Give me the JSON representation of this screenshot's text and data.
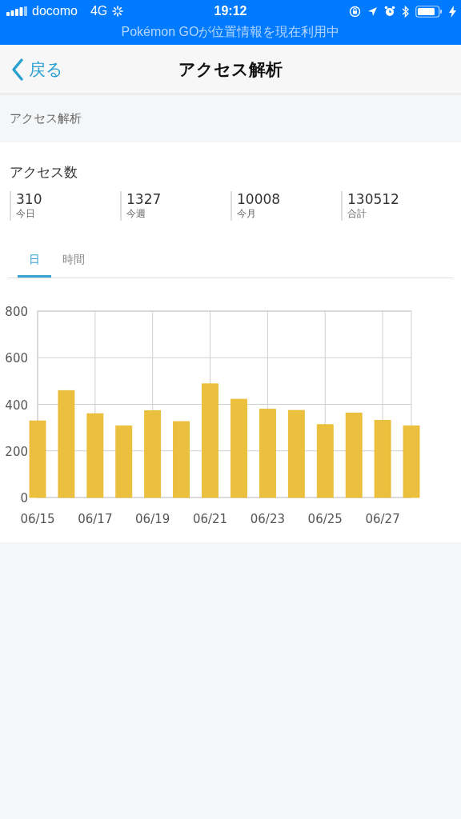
{
  "status_bar": {
    "carrier": "docomo",
    "network": "4G",
    "time": "19:12",
    "banner": "Pokémon GOが位置情報を現在利用中"
  },
  "nav": {
    "back": "戻る",
    "title": "アクセス解析"
  },
  "section_header": "アクセス解析",
  "card": {
    "title": "アクセス数",
    "stats": [
      {
        "value": "310",
        "label": "今日"
      },
      {
        "value": "1327",
        "label": "今週"
      },
      {
        "value": "10008",
        "label": "今月"
      },
      {
        "value": "130512",
        "label": "合計"
      }
    ],
    "tabs": [
      {
        "label": "日",
        "selected": true
      },
      {
        "label": "時間",
        "selected": false
      }
    ],
    "chart_data": {
      "type": "bar",
      "grid": true,
      "categories": [
        "06/15",
        null,
        "06/17",
        null,
        "06/19",
        null,
        "06/21",
        null,
        "06/23",
        null,
        "06/25",
        null,
        "06/27",
        null
      ],
      "series": [
        {
          "color": "#ebc03f",
          "values": [
            329,
            459,
            360,
            307,
            373,
            326,
            488,
            422,
            379,
            374,
            313,
            363,
            331,
            307
          ]
        }
      ],
      "ylim": [
        0,
        800
      ],
      "yticks": [
        0,
        200,
        400,
        600,
        800
      ]
    }
  }
}
